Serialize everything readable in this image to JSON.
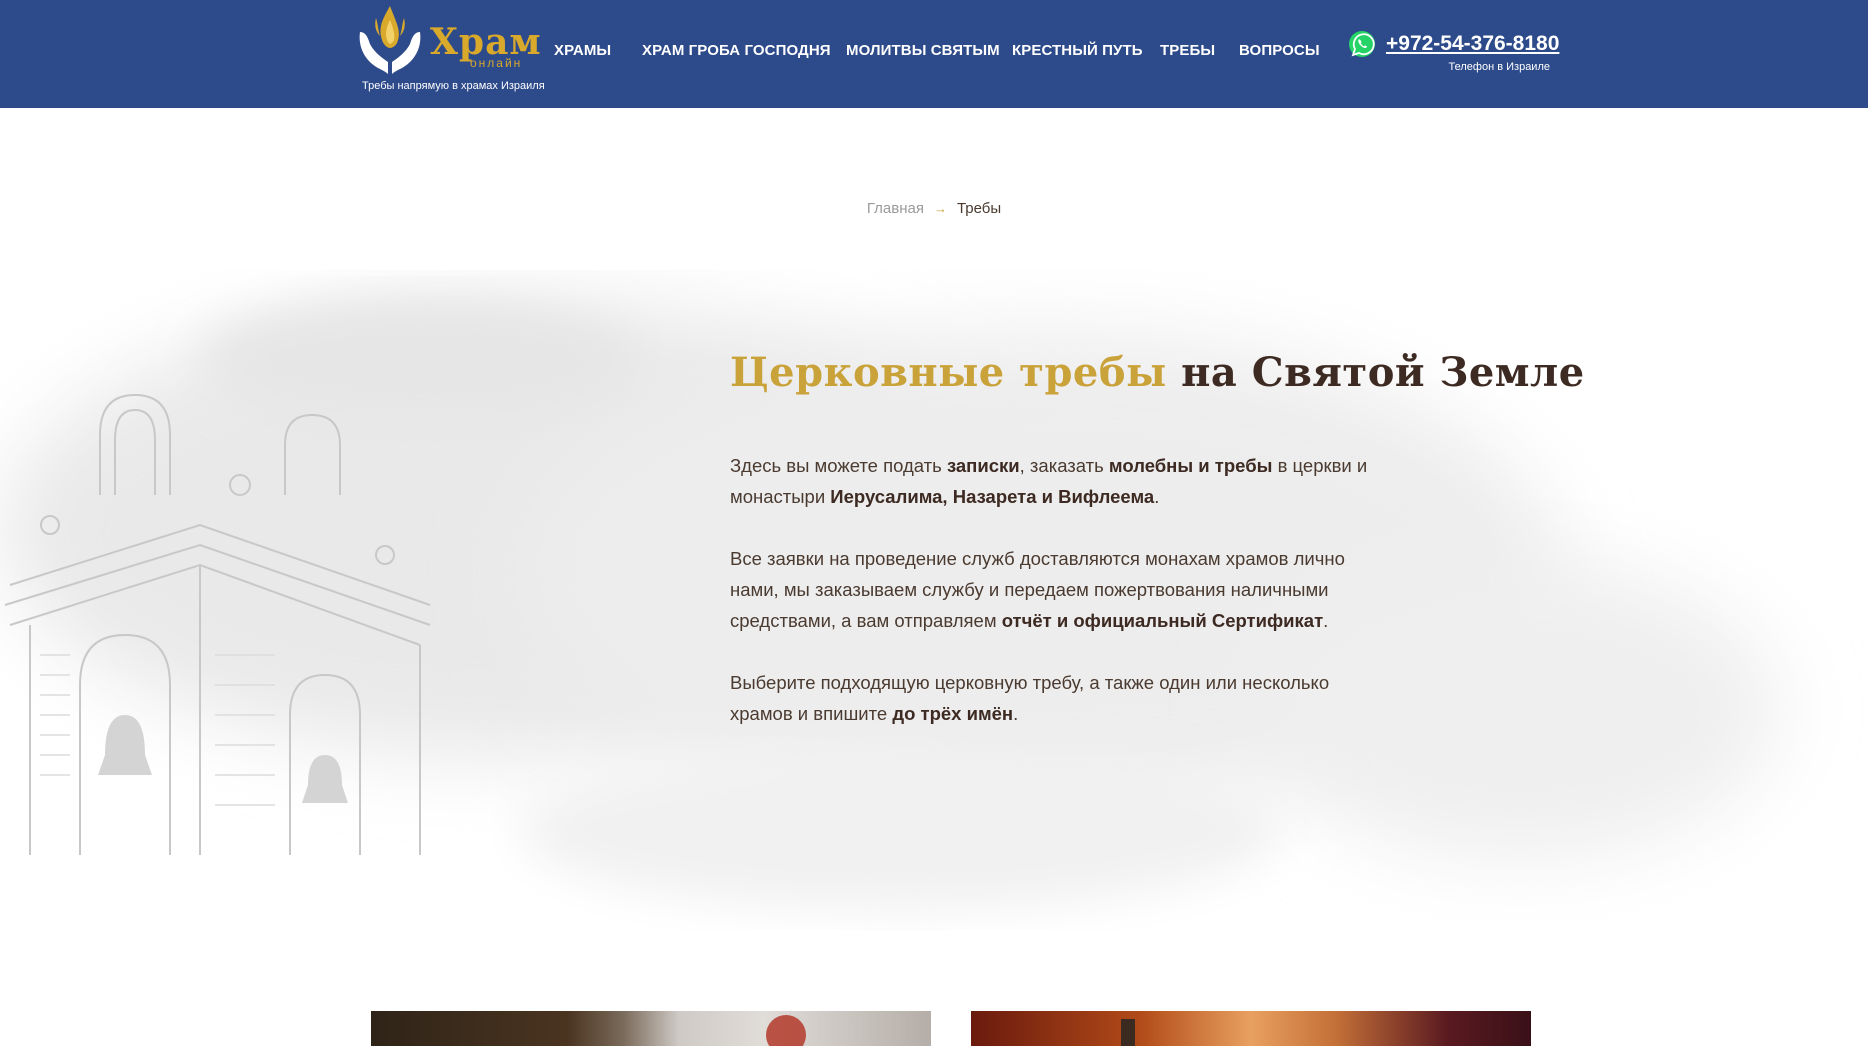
{
  "header": {
    "logo": {
      "word": "Храм",
      "sub": "онлайн",
      "tagline": "Требы напрямую в храмах Израиля"
    },
    "nav": [
      {
        "label": "ХРАМЫ"
      },
      {
        "label": "ХРАМ ГРОБА ГОСПОДНЯ"
      },
      {
        "label": "МОЛИТВЫ СВЯТЫМ"
      },
      {
        "label": "КРЕСТНЫЙ ПУТЬ"
      },
      {
        "label": "ТРЕБЫ"
      },
      {
        "label": "ВОПРОСЫ"
      }
    ],
    "contact": {
      "icon": "whatsapp-icon",
      "phone": "+972-54-376-8180",
      "caption": "Телефон в Израиле"
    }
  },
  "breadcrumb": {
    "home": "Главная",
    "separator": "→",
    "current": "Требы"
  },
  "hero": {
    "title_gold": "Церковные требы",
    "title_dark": "на Святой Земле",
    "p1": {
      "t1": "Здесь вы можете подать ",
      "b1": "записки",
      "t2": ", заказать ",
      "b2": "молебны и требы",
      "t3": " в церкви и монастыри ",
      "b3": "Иерусалима, Назарета и Вифлеема",
      "t4": "."
    },
    "p2": {
      "t1": "Все заявки на проведение служб доставляются монахам храмов лично нами, мы заказываем службу и передаем пожертвования наличными средствами, а вам отправляем ",
      "b1": "отчёт и официальный Сертификат",
      "t2": "."
    },
    "p3": {
      "t1": "Выберите подходящую церковную требу, а также один или несколько храмов и впишите ",
      "b1": "до трёх имён",
      "t2": "."
    }
  },
  "colors": {
    "header_bg": "#2d4a8a",
    "gold": "#c9a23a",
    "logo_gold": "#d9a92c",
    "text_dark": "#3d2a22",
    "text": "#4a3a30",
    "muted": "#9a9a9a",
    "whatsapp": "#25d366"
  }
}
